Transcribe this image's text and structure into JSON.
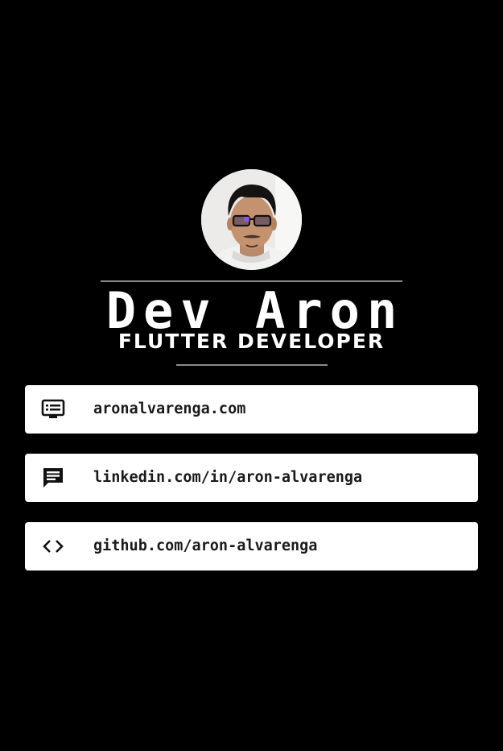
{
  "profile": {
    "name": "Dev Aron",
    "role": "FLUTTER DEVELOPER"
  },
  "links": [
    {
      "icon": "web-icon",
      "label": "aronalvarenga.com"
    },
    {
      "icon": "message-icon",
      "label": "linkedin.com/in/aron-alvarenga"
    },
    {
      "icon": "code-icon",
      "label": "github.com/aron-alvarenga"
    }
  ],
  "colors": {
    "background": "#000000",
    "card": "#ffffff",
    "text_on_card": "#1a1a1a",
    "divider": "#8a8a8a"
  }
}
